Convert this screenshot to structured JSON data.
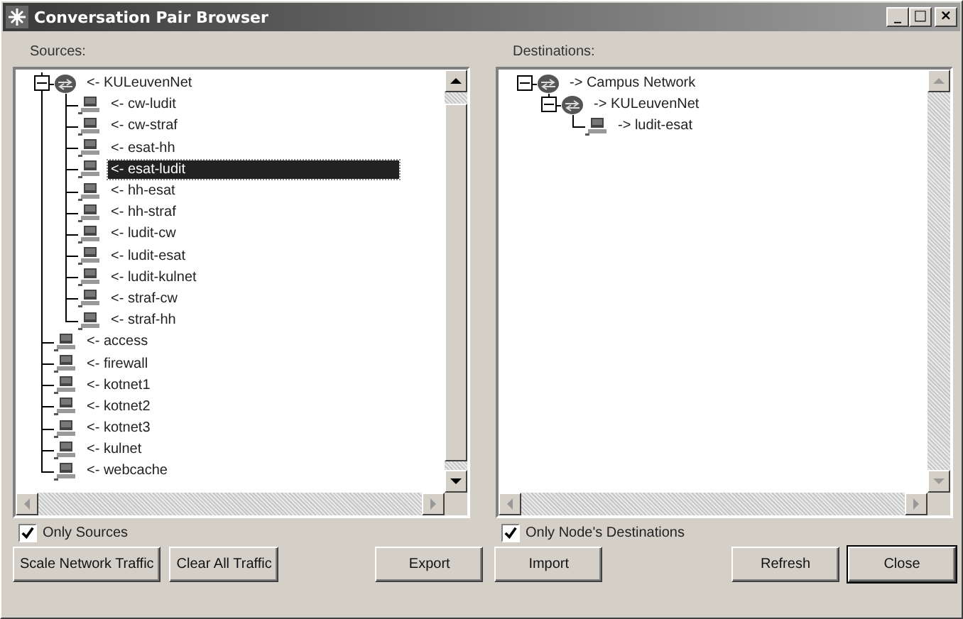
{
  "window": {
    "title": "Conversation Pair Browser",
    "controls": [
      "_",
      "□",
      "×"
    ]
  },
  "sources": {
    "label": "Sources:",
    "items": [
      {
        "label": "<- KULeuvenNet",
        "kind": "network",
        "expanded": true,
        "selected": false,
        "children": [
          {
            "label": "<- cw-ludit",
            "kind": "host",
            "selected": false
          },
          {
            "label": "<- cw-straf",
            "kind": "host",
            "selected": false
          },
          {
            "label": "<- esat-hh",
            "kind": "host",
            "selected": false
          },
          {
            "label": "<- esat-ludit",
            "kind": "host",
            "selected": true
          },
          {
            "label": "<- hh-esat",
            "kind": "host",
            "selected": false
          },
          {
            "label": "<- hh-straf",
            "kind": "host",
            "selected": false
          },
          {
            "label": "<- ludit-cw",
            "kind": "host",
            "selected": false
          },
          {
            "label": "<- ludit-esat",
            "kind": "host",
            "selected": false
          },
          {
            "label": "<- ludit-kulnet",
            "kind": "host",
            "selected": false
          },
          {
            "label": "<- straf-cw",
            "kind": "host",
            "selected": false
          },
          {
            "label": "<- straf-hh",
            "kind": "host",
            "selected": false
          }
        ]
      },
      {
        "label": "<- access",
        "kind": "host",
        "selected": false
      },
      {
        "label": "<- firewall",
        "kind": "host",
        "selected": false
      },
      {
        "label": "<- kotnet1",
        "kind": "host",
        "selected": false
      },
      {
        "label": "<- kotnet2",
        "kind": "host",
        "selected": false
      },
      {
        "label": "<- kotnet3",
        "kind": "host",
        "selected": false
      },
      {
        "label": "<- kulnet",
        "kind": "host",
        "selected": false
      },
      {
        "label": "<- webcache",
        "kind": "host",
        "selected": false
      }
    ],
    "scrollable": true,
    "checkbox": {
      "label": "Only Sources",
      "checked": true
    }
  },
  "destinations": {
    "label": "Destinations:",
    "items": [
      {
        "label": "-> Campus Network",
        "kind": "network",
        "expanded": true,
        "selected": false,
        "children": [
          {
            "label": "-> KULeuvenNet",
            "kind": "network",
            "expanded": true,
            "selected": false,
            "children": [
              {
                "label": "-> ludit-esat",
                "kind": "host",
                "selected": false
              }
            ]
          }
        ]
      }
    ],
    "scrollable": false,
    "checkbox": {
      "label": "Only Node's Destinations",
      "checked": true
    }
  },
  "buttons_left": [
    {
      "label": "Scale Network Traffic",
      "default": false
    },
    {
      "label": "Clear All Traffic",
      "default": false
    }
  ],
  "buttons_center": [
    {
      "label": "Export",
      "default": false
    },
    {
      "label": "Import",
      "default": false
    }
  ],
  "buttons_right": [
    {
      "label": "Refresh",
      "default": false
    },
    {
      "label": "Close",
      "default": true
    }
  ]
}
